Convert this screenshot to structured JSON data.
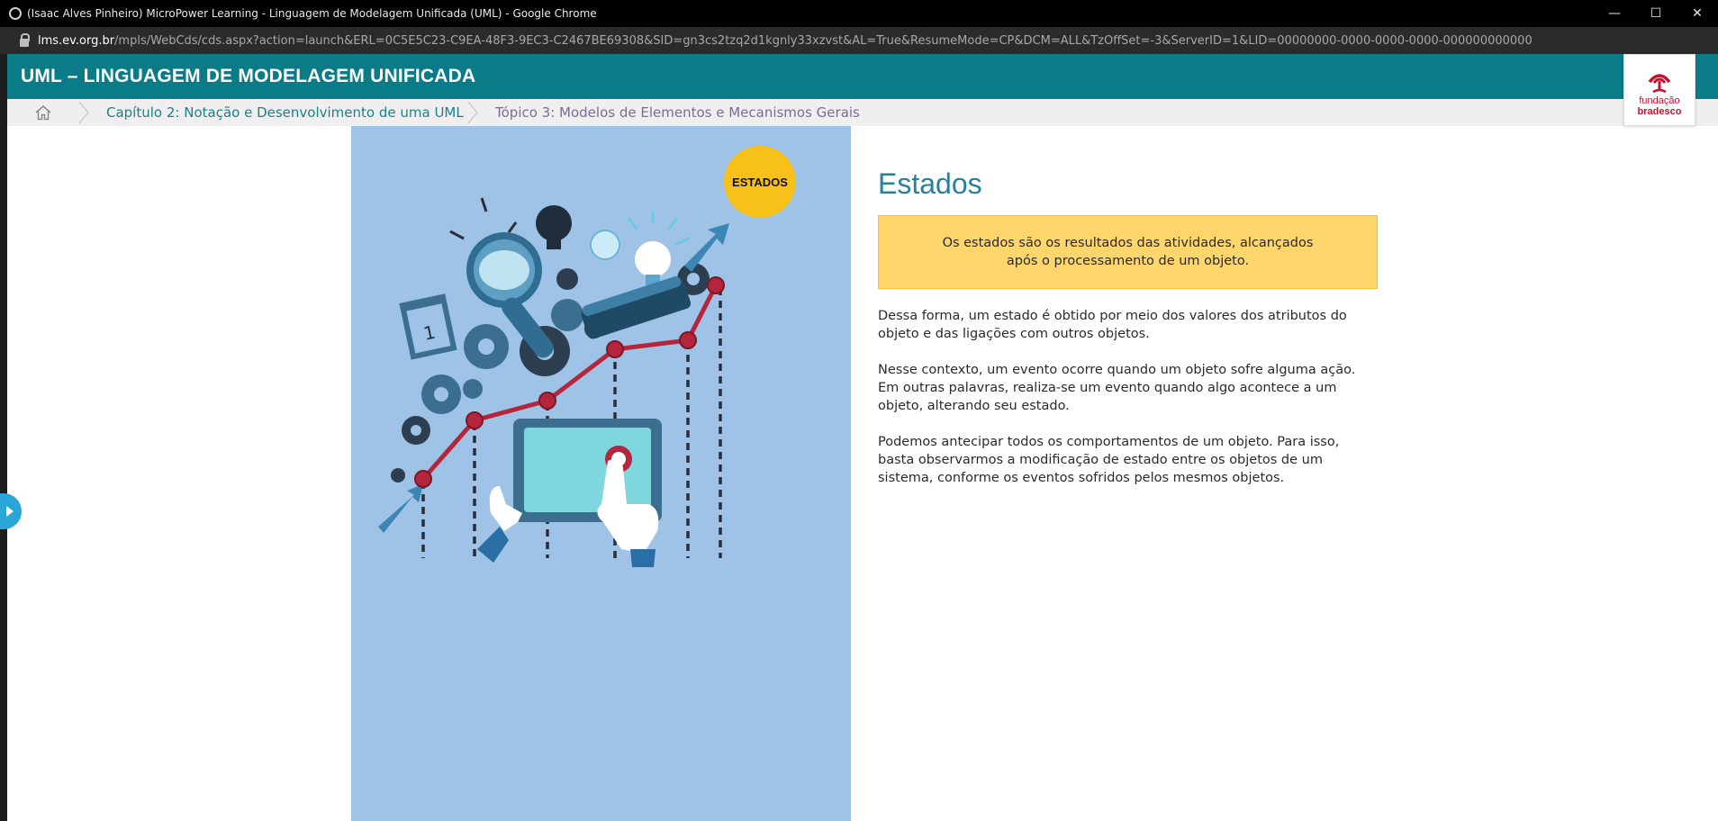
{
  "window": {
    "title": "(Isaac Alves Pinheiro) MicroPower Learning - Linguagem de Modelagem Unificada (UML) - Google Chrome",
    "minimize": "—",
    "maximize": "☐",
    "close": "✕"
  },
  "url": {
    "host": "lms.ev.org.br",
    "path": "/mpls/WebCds/cds.aspx?action=launch&ERL=0C5E5C23-C9EA-48F3-9EC3-C2467BE69308&SID=gn3cs2tzq2d1kgnly33xzvst&AL=True&ResumeMode=CP&DCM=ALL&TzOffSet=-3&ServerID=1&LID=00000000-0000-0000-0000-000000000000"
  },
  "course": {
    "title": "UML – LINGUAGEM DE MODELAGEM UNIFICADA"
  },
  "breadcrumb": {
    "chapter": "Capítulo 2: Notação e Desenvolvimento de uma UML",
    "topic": "Tópico 3: Modelos de Elementos e Mecanismos Gerais"
  },
  "logo": {
    "line1": "fundação",
    "line2": "bradesco",
    "color": "#c8102e"
  },
  "illustration": {
    "badge": "ESTADOS",
    "calendar_digit": "1"
  },
  "content": {
    "heading": "Estados",
    "highlight": "Os estados são os resultados das atividades, alcançados após o processamento de um objeto.",
    "paragraphs": [
      "Dessa forma, um estado é obtido por meio dos valores dos atributos do objeto e das ligações com outros objetos.",
      "Nesse contexto, um evento ocorre quando um objeto sofre alguma ação. Em outras palavras, realiza-se um evento quando algo acontece a um objeto, alterando seu estado.",
      "Podemos antecipar todos os comportamentos de um objeto. Para isso, basta observarmos a modificação de estado entre os objetos de um sistema, conforme os eventos sofridos pelos mesmos objetos."
    ]
  },
  "colors": {
    "header_teal": "#0a7c87",
    "panel_blue": "#9ec3e6",
    "highlight_yellow": "#ffd66b",
    "badge_yellow": "#f8c11a",
    "heading_blue": "#2a7f9a"
  }
}
